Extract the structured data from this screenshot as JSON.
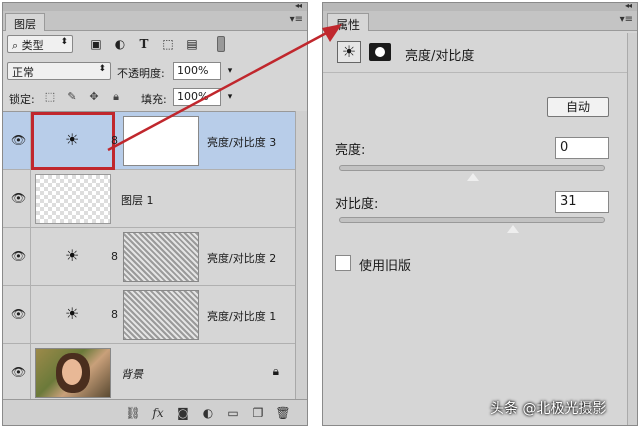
{
  "layers_panel": {
    "tab_label": "图层",
    "collapse": "◂◂",
    "menu": "▾≡",
    "filter": {
      "label": "类型",
      "icons": [
        "image-filter-icon",
        "adjustment-filter-icon",
        "type-filter-icon",
        "shape-filter-icon",
        "smart-object-filter-icon"
      ]
    },
    "blend_mode": "正常",
    "opacity_label": "不透明度:",
    "opacity_value": "100%",
    "lock_label": "锁定:",
    "fill_label": "填充:",
    "fill_value": "100%",
    "layers": [
      {
        "name": "亮度/对比度 3",
        "kind": "adjustment",
        "selected": true
      },
      {
        "name": "图层 1",
        "kind": "pixel-empty",
        "selected": false
      },
      {
        "name": "亮度/对比度 2",
        "kind": "adjustment",
        "selected": false
      },
      {
        "name": "亮度/对比度 1",
        "kind": "adjustment",
        "selected": false
      },
      {
        "name": "背景",
        "kind": "background",
        "selected": false
      }
    ],
    "bottom_icons": [
      "link-icon",
      "fx-icon",
      "add-mask-icon",
      "new-adjustment-icon",
      "new-group-icon",
      "new-layer-icon",
      "delete-icon"
    ],
    "fx_text": "fx"
  },
  "props_panel": {
    "tab_label": "属性",
    "collapse": "◂◂",
    "menu": "▾≡",
    "title": "亮度/对比度",
    "auto_label": "自动",
    "brightness": {
      "label": "亮度:",
      "value": "0",
      "slider_fraction": 0.5
    },
    "contrast": {
      "label": "对比度:",
      "value": "31",
      "slider_fraction": 0.65
    },
    "legacy_label": "使用旧版"
  },
  "watermark": "头条 @北极光摄影",
  "colors": {
    "selection_frame": "#c0272d",
    "selected_row": "#b8cde9"
  }
}
